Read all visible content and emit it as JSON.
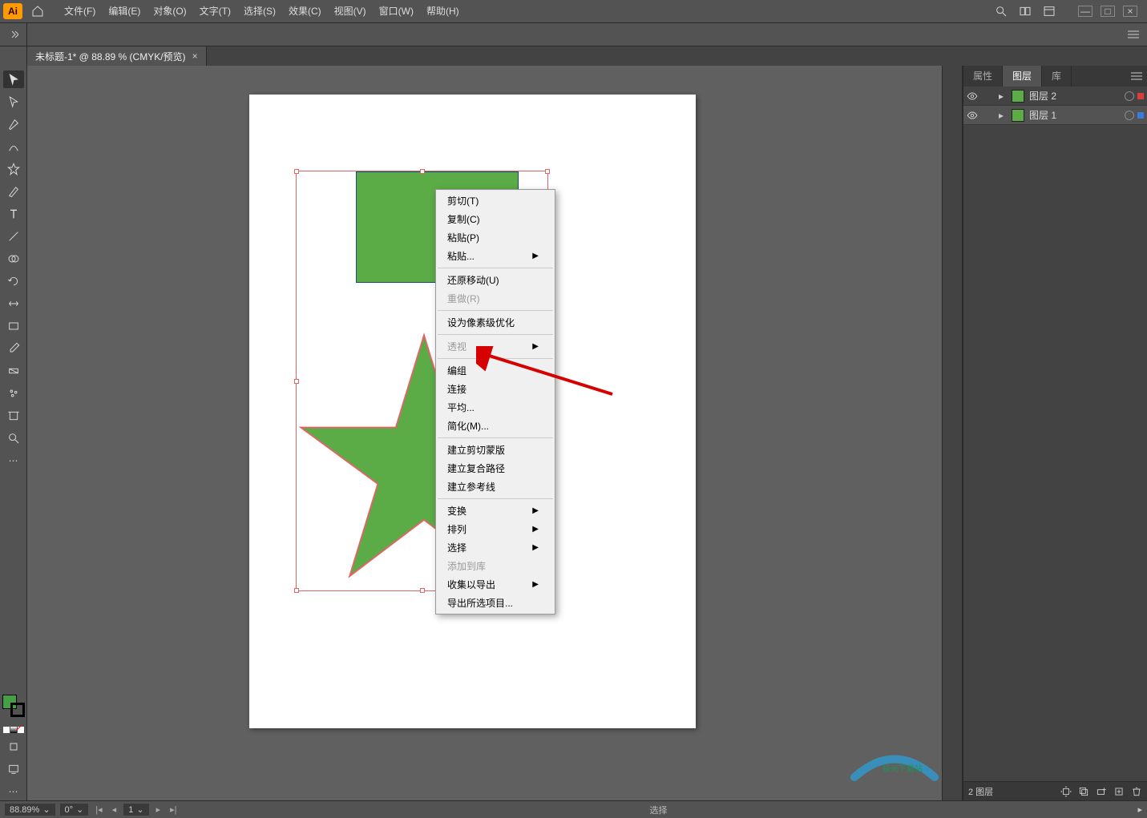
{
  "menubar": {
    "items": [
      "文件(F)",
      "编辑(E)",
      "对象(O)",
      "文字(T)",
      "选择(S)",
      "效果(C)",
      "视图(V)",
      "窗口(W)",
      "帮助(H)"
    ]
  },
  "tab": {
    "title": "未标题-1* @ 88.89 % (CMYK/预览)"
  },
  "context_menu": {
    "groups": [
      [
        {
          "label": "剪切(T)",
          "enabled": true
        },
        {
          "label": "复制(C)",
          "enabled": true
        },
        {
          "label": "粘贴(P)",
          "enabled": true
        },
        {
          "label": "粘贴...",
          "enabled": true,
          "submenu": true
        }
      ],
      [
        {
          "label": "还原移动(U)",
          "enabled": true
        },
        {
          "label": "重做(R)",
          "enabled": false
        }
      ],
      [
        {
          "label": "设为像素级优化",
          "enabled": true
        }
      ],
      [
        {
          "label": "透视",
          "enabled": false,
          "submenu": true
        }
      ],
      [
        {
          "label": "编组",
          "enabled": true
        },
        {
          "label": "连接",
          "enabled": true
        },
        {
          "label": "平均...",
          "enabled": true
        },
        {
          "label": "简化(M)...",
          "enabled": true
        }
      ],
      [
        {
          "label": "建立剪切蒙版",
          "enabled": true
        },
        {
          "label": "建立复合路径",
          "enabled": true
        },
        {
          "label": "建立参考线",
          "enabled": true
        }
      ],
      [
        {
          "label": "变换",
          "enabled": true,
          "submenu": true
        },
        {
          "label": "排列",
          "enabled": true,
          "submenu": true
        },
        {
          "label": "选择",
          "enabled": true,
          "submenu": true
        },
        {
          "label": "添加到库",
          "enabled": false
        },
        {
          "label": "收集以导出",
          "enabled": true,
          "submenu": true
        },
        {
          "label": "导出所选项目...",
          "enabled": true
        }
      ]
    ]
  },
  "panels": {
    "tabs": [
      "属性",
      "图层",
      "库"
    ],
    "active_tab": "图层",
    "layers": [
      {
        "name": "图层 2",
        "color": "#5bab46",
        "selected": false,
        "sel_color": "#de3b3b"
      },
      {
        "name": "图层 1",
        "color": "#5bab46",
        "selected": true,
        "sel_color": "#3b7dde"
      }
    ],
    "footer": {
      "count_label": "2 图层"
    }
  },
  "status": {
    "zoom": "88.89%",
    "rotation": "0°",
    "page": "1",
    "mode": "选择"
  },
  "colors": {
    "shape_fill": "#5bab46",
    "shape_stroke": "#1a4c7a",
    "selection": "#e06666",
    "arrow": "#d60000"
  }
}
